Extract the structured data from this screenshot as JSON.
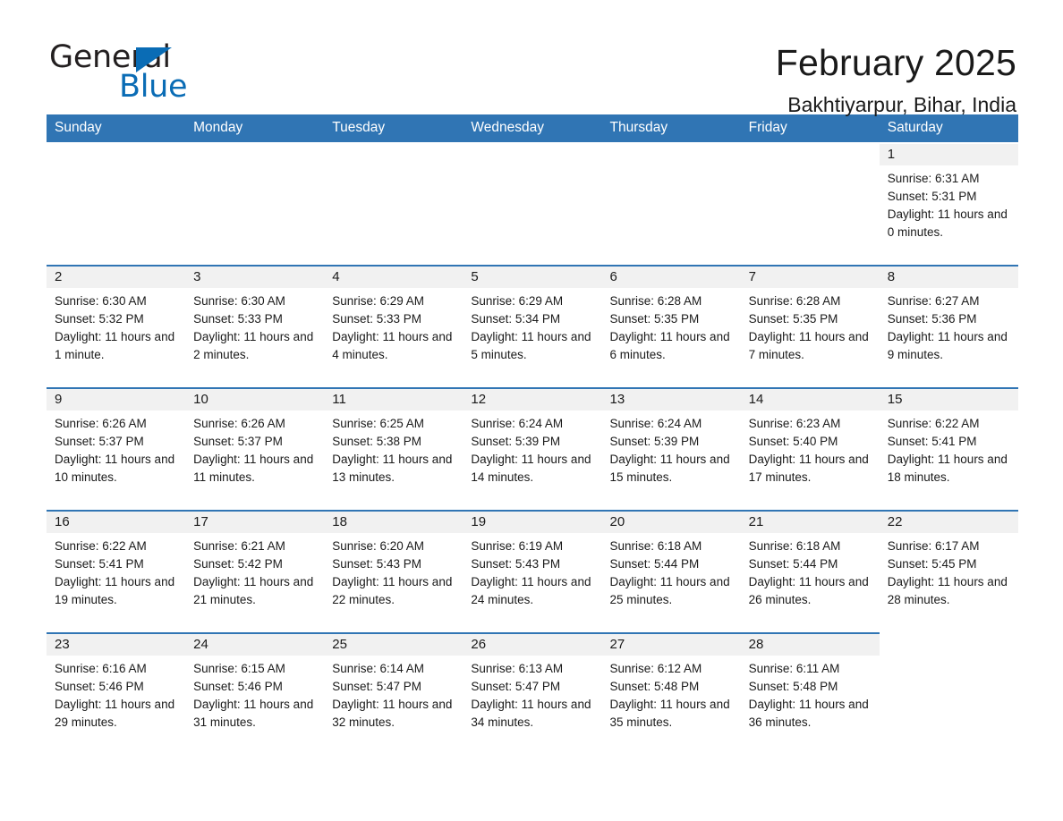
{
  "logo": {
    "word_top": "General",
    "word_bottom": "Blue",
    "triangle_color": "#0a6cb5"
  },
  "header": {
    "title": "February 2025",
    "subtitle": "Bakhtiyarpur, Bihar, India"
  },
  "theme": {
    "header_blue": "#3075b4",
    "rule_blue": "#3075b4",
    "daynum_strip": "#f1f1f1",
    "text": "#1a1a1a"
  },
  "weekdays": [
    "Sunday",
    "Monday",
    "Tuesday",
    "Wednesday",
    "Thursday",
    "Friday",
    "Saturday"
  ],
  "weeks": [
    [
      {
        "day": "",
        "blank": true,
        "sunrise": "",
        "sunset": "",
        "daylight": ""
      },
      {
        "day": "",
        "blank": true,
        "sunrise": "",
        "sunset": "",
        "daylight": ""
      },
      {
        "day": "",
        "blank": true,
        "sunrise": "",
        "sunset": "",
        "daylight": ""
      },
      {
        "day": "",
        "blank": true,
        "sunrise": "",
        "sunset": "",
        "daylight": ""
      },
      {
        "day": "",
        "blank": true,
        "sunrise": "",
        "sunset": "",
        "daylight": ""
      },
      {
        "day": "",
        "blank": true,
        "sunrise": "",
        "sunset": "",
        "daylight": ""
      },
      {
        "day": "1",
        "blank": false,
        "sunrise": "Sunrise: 6:31 AM",
        "sunset": "Sunset: 5:31 PM",
        "daylight": "Daylight: 11 hours and 0 minutes."
      }
    ],
    [
      {
        "day": "2",
        "blank": false,
        "sunrise": "Sunrise: 6:30 AM",
        "sunset": "Sunset: 5:32 PM",
        "daylight": "Daylight: 11 hours and 1 minute."
      },
      {
        "day": "3",
        "blank": false,
        "sunrise": "Sunrise: 6:30 AM",
        "sunset": "Sunset: 5:33 PM",
        "daylight": "Daylight: 11 hours and 2 minutes."
      },
      {
        "day": "4",
        "blank": false,
        "sunrise": "Sunrise: 6:29 AM",
        "sunset": "Sunset: 5:33 PM",
        "daylight": "Daylight: 11 hours and 4 minutes."
      },
      {
        "day": "5",
        "blank": false,
        "sunrise": "Sunrise: 6:29 AM",
        "sunset": "Sunset: 5:34 PM",
        "daylight": "Daylight: 11 hours and 5 minutes."
      },
      {
        "day": "6",
        "blank": false,
        "sunrise": "Sunrise: 6:28 AM",
        "sunset": "Sunset: 5:35 PM",
        "daylight": "Daylight: 11 hours and 6 minutes."
      },
      {
        "day": "7",
        "blank": false,
        "sunrise": "Sunrise: 6:28 AM",
        "sunset": "Sunset: 5:35 PM",
        "daylight": "Daylight: 11 hours and 7 minutes."
      },
      {
        "day": "8",
        "blank": false,
        "sunrise": "Sunrise: 6:27 AM",
        "sunset": "Sunset: 5:36 PM",
        "daylight": "Daylight: 11 hours and 9 minutes."
      }
    ],
    [
      {
        "day": "9",
        "blank": false,
        "sunrise": "Sunrise: 6:26 AM",
        "sunset": "Sunset: 5:37 PM",
        "daylight": "Daylight: 11 hours and 10 minutes."
      },
      {
        "day": "10",
        "blank": false,
        "sunrise": "Sunrise: 6:26 AM",
        "sunset": "Sunset: 5:37 PM",
        "daylight": "Daylight: 11 hours and 11 minutes."
      },
      {
        "day": "11",
        "blank": false,
        "sunrise": "Sunrise: 6:25 AM",
        "sunset": "Sunset: 5:38 PM",
        "daylight": "Daylight: 11 hours and 13 minutes."
      },
      {
        "day": "12",
        "blank": false,
        "sunrise": "Sunrise: 6:24 AM",
        "sunset": "Sunset: 5:39 PM",
        "daylight": "Daylight: 11 hours and 14 minutes."
      },
      {
        "day": "13",
        "blank": false,
        "sunrise": "Sunrise: 6:24 AM",
        "sunset": "Sunset: 5:39 PM",
        "daylight": "Daylight: 11 hours and 15 minutes."
      },
      {
        "day": "14",
        "blank": false,
        "sunrise": "Sunrise: 6:23 AM",
        "sunset": "Sunset: 5:40 PM",
        "daylight": "Daylight: 11 hours and 17 minutes."
      },
      {
        "day": "15",
        "blank": false,
        "sunrise": "Sunrise: 6:22 AM",
        "sunset": "Sunset: 5:41 PM",
        "daylight": "Daylight: 11 hours and 18 minutes."
      }
    ],
    [
      {
        "day": "16",
        "blank": false,
        "sunrise": "Sunrise: 6:22 AM",
        "sunset": "Sunset: 5:41 PM",
        "daylight": "Daylight: 11 hours and 19 minutes."
      },
      {
        "day": "17",
        "blank": false,
        "sunrise": "Sunrise: 6:21 AM",
        "sunset": "Sunset: 5:42 PM",
        "daylight": "Daylight: 11 hours and 21 minutes."
      },
      {
        "day": "18",
        "blank": false,
        "sunrise": "Sunrise: 6:20 AM",
        "sunset": "Sunset: 5:43 PM",
        "daylight": "Daylight: 11 hours and 22 minutes."
      },
      {
        "day": "19",
        "blank": false,
        "sunrise": "Sunrise: 6:19 AM",
        "sunset": "Sunset: 5:43 PM",
        "daylight": "Daylight: 11 hours and 24 minutes."
      },
      {
        "day": "20",
        "blank": false,
        "sunrise": "Sunrise: 6:18 AM",
        "sunset": "Sunset: 5:44 PM",
        "daylight": "Daylight: 11 hours and 25 minutes."
      },
      {
        "day": "21",
        "blank": false,
        "sunrise": "Sunrise: 6:18 AM",
        "sunset": "Sunset: 5:44 PM",
        "daylight": "Daylight: 11 hours and 26 minutes."
      },
      {
        "day": "22",
        "blank": false,
        "sunrise": "Sunrise: 6:17 AM",
        "sunset": "Sunset: 5:45 PM",
        "daylight": "Daylight: 11 hours and 28 minutes."
      }
    ],
    [
      {
        "day": "23",
        "blank": false,
        "sunrise": "Sunrise: 6:16 AM",
        "sunset": "Sunset: 5:46 PM",
        "daylight": "Daylight: 11 hours and 29 minutes."
      },
      {
        "day": "24",
        "blank": false,
        "sunrise": "Sunrise: 6:15 AM",
        "sunset": "Sunset: 5:46 PM",
        "daylight": "Daylight: 11 hours and 31 minutes."
      },
      {
        "day": "25",
        "blank": false,
        "sunrise": "Sunrise: 6:14 AM",
        "sunset": "Sunset: 5:47 PM",
        "daylight": "Daylight: 11 hours and 32 minutes."
      },
      {
        "day": "26",
        "blank": false,
        "sunrise": "Sunrise: 6:13 AM",
        "sunset": "Sunset: 5:47 PM",
        "daylight": "Daylight: 11 hours and 34 minutes."
      },
      {
        "day": "27",
        "blank": false,
        "sunrise": "Sunrise: 6:12 AM",
        "sunset": "Sunset: 5:48 PM",
        "daylight": "Daylight: 11 hours and 35 minutes."
      },
      {
        "day": "28",
        "blank": false,
        "sunrise": "Sunrise: 6:11 AM",
        "sunset": "Sunset: 5:48 PM",
        "daylight": "Daylight: 11 hours and 36 minutes."
      },
      {
        "day": "",
        "blank": true,
        "sunrise": "",
        "sunset": "",
        "daylight": ""
      }
    ]
  ]
}
